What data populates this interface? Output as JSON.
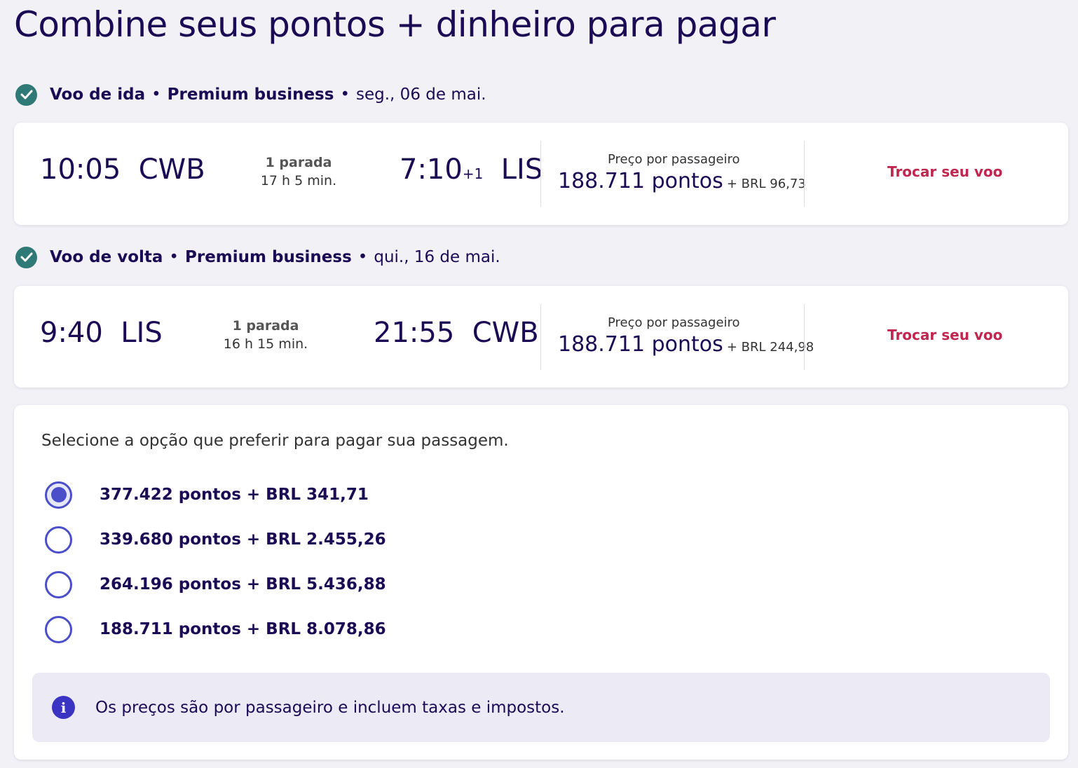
{
  "page": {
    "title": "Combine seus pontos + dinheiro para pagar"
  },
  "segments": [
    {
      "direction": "Voo de ida",
      "cabin": "Premium business",
      "date": "seg., 06 de mai.",
      "depart_time": "10:05",
      "depart_airport": "CWB",
      "stops": "1 parada",
      "duration": "17 h 5 min.",
      "arrive_time": "7:10",
      "day_offset": "+1",
      "arrive_airport": "LIS",
      "price_label": "Preço por passageiro",
      "price_points": "188.711 pontos",
      "price_cash": "+ BRL 96,73",
      "change_label": "Trocar seu voo"
    },
    {
      "direction": "Voo de volta",
      "cabin": "Premium business",
      "date": "qui., 16 de mai.",
      "depart_time": "9:40",
      "depart_airport": "LIS",
      "stops": "1 parada",
      "duration": "16 h 15 min.",
      "arrive_time": "21:55",
      "day_offset": "",
      "arrive_airport": "CWB",
      "price_label": "Preço por passageiro",
      "price_points": "188.711 pontos",
      "price_cash": "+ BRL 244,98",
      "change_label": "Trocar seu voo"
    }
  ],
  "payment": {
    "instruction": "Selecione a opção que preferir para pagar sua passagem.",
    "options": [
      {
        "label": "377.422 pontos + BRL 341,71",
        "selected": true
      },
      {
        "label": "339.680 pontos + BRL 2.455,26",
        "selected": false
      },
      {
        "label": "264.196 pontos + BRL 5.436,88",
        "selected": false
      },
      {
        "label": "188.711 pontos + BRL 8.078,86",
        "selected": false
      }
    ],
    "info_icon": "info-icon",
    "info_text": "Os preços são por passageiro e incluem taxas e impostos."
  },
  "colors": {
    "brand_navy": "#1b0b54",
    "accent_link": "#c0264f",
    "radio": "#4a4fc9",
    "check": "#2f7a76"
  }
}
